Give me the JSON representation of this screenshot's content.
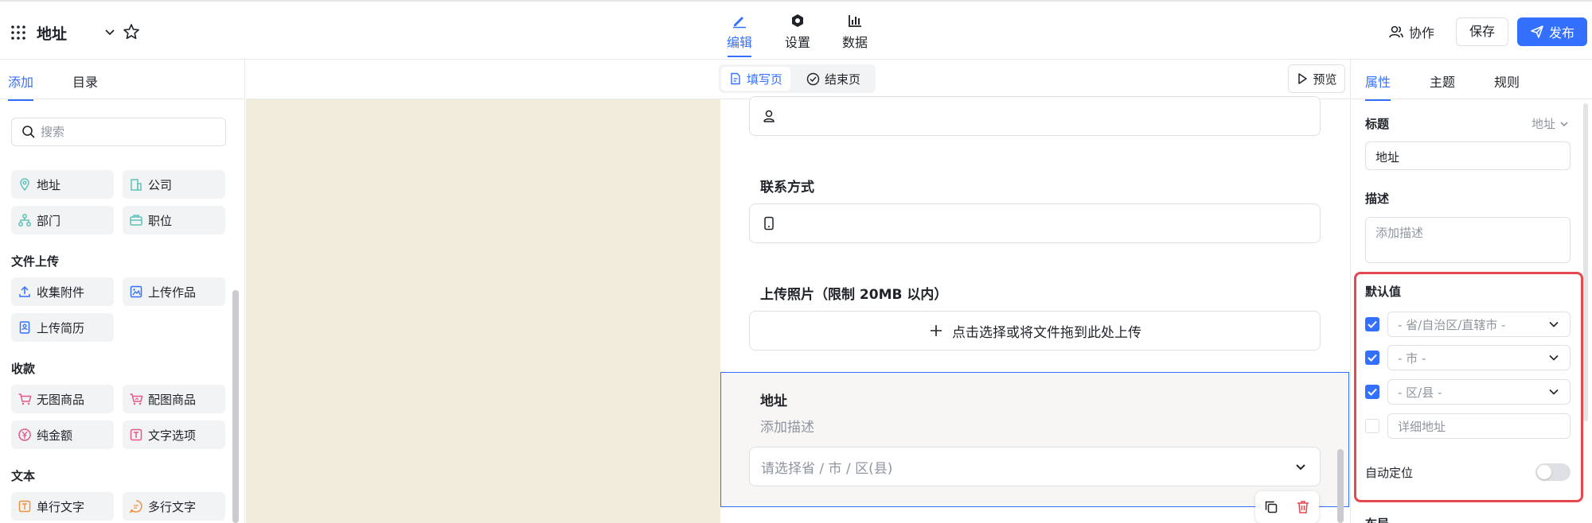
{
  "header": {
    "app_title": "地址",
    "tabs": [
      {
        "label": "编辑",
        "icon": "pen-icon",
        "active": true
      },
      {
        "label": "设置",
        "icon": "hexagon-settings-icon",
        "active": false
      },
      {
        "label": "数据",
        "icon": "bar-chart-icon",
        "active": false
      }
    ],
    "collab_label": "协作",
    "save_label": "保存",
    "publish_label": "发布"
  },
  "left_panel": {
    "tabs": [
      {
        "label": "添加",
        "active": true
      },
      {
        "label": "目录",
        "active": false
      }
    ],
    "search_placeholder": "搜索",
    "items_top": [
      {
        "label": "地址",
        "icon": "location-icon"
      },
      {
        "label": "公司",
        "icon": "building-icon"
      },
      {
        "label": "部门",
        "icon": "org-chart-icon"
      },
      {
        "label": "职位",
        "icon": "briefcase-icon"
      }
    ],
    "sections": [
      {
        "title": "文件上传",
        "items": [
          {
            "label": "收集附件",
            "icon": "upload-icon"
          },
          {
            "label": "上传作品",
            "icon": "image-upload-icon"
          },
          {
            "label": "上传简历",
            "icon": "resume-icon"
          }
        ]
      },
      {
        "title": "收款",
        "items": [
          {
            "label": "无图商品",
            "icon": "cart-icon"
          },
          {
            "label": "配图商品",
            "icon": "cart-image-icon"
          },
          {
            "label": "纯金额",
            "icon": "yuan-icon"
          },
          {
            "label": "文字选项",
            "icon": "text-option-icon"
          }
        ]
      },
      {
        "title": "文本",
        "items": [
          {
            "label": "单行文字",
            "icon": "single-line-text-icon"
          },
          {
            "label": "多行文字",
            "icon": "multi-line-text-icon"
          }
        ]
      }
    ]
  },
  "toolbar": {
    "fill_page_label": "填写页",
    "end_page_label": "结束页",
    "preview_label": "预览"
  },
  "form": {
    "contact_title": "联系方式",
    "upload_title": "上传照片（限制 20MB 以内）",
    "upload_hint": "点击选择或将文件拖到此处上传",
    "address_title": "地址",
    "address_desc": "添加描述",
    "address_placeholder": "请选择省 / 市 / 区(县)"
  },
  "right_panel": {
    "tabs": [
      {
        "label": "属性",
        "active": true
      },
      {
        "label": "主题",
        "active": false
      },
      {
        "label": "规则",
        "active": false
      }
    ],
    "title_label": "标题",
    "title_type": "地址",
    "title_value": "地址",
    "desc_label": "描述",
    "desc_placeholder": "添加描述",
    "default_label": "默认值",
    "defaults": [
      {
        "checked": true,
        "placeholder": "- 省/自治区/直辖市 -"
      },
      {
        "checked": true,
        "placeholder": "- 市 -"
      },
      {
        "checked": true,
        "placeholder": "- 区/县 -"
      },
      {
        "checked": false,
        "placeholder": "详细地址"
      }
    ],
    "auto_locate_label": "自动定位",
    "auto_locate_on": false,
    "next_section_label": "布局"
  },
  "colors": {
    "accent": "#3370ff",
    "highlight": "#e5484d",
    "canvas_bg": "#f2ecdc"
  }
}
